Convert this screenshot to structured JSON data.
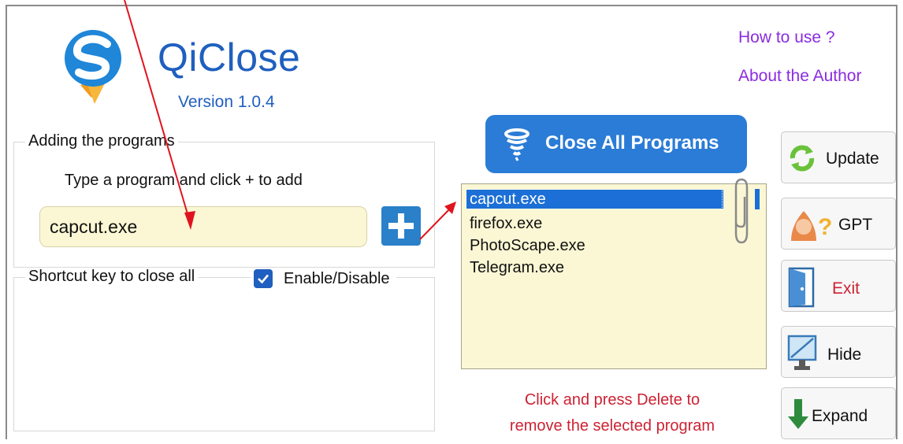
{
  "app": {
    "title": "QiClose",
    "version": "Version 1.0.4"
  },
  "links": {
    "how_to_use": "How to use ?",
    "about_author": "About the Author"
  },
  "add_group": {
    "title": "Adding the programs",
    "hint": "Type a program and click +  to add",
    "input_value": "capcut.exe"
  },
  "shortcut_group": {
    "title": "Shortcut key to close all",
    "checkbox_label": "Enable/Disable",
    "checkbox_checked": true
  },
  "close_all_label": "Close All Programs",
  "program_list": {
    "items": [
      "capcut.exe",
      "firefox.exe",
      "PhotoScape.exe",
      "Telegram.exe"
    ],
    "selected": "capcut.exe"
  },
  "remove_note": {
    "line1": "Click and press Delete to",
    "line2": "remove the selected program"
  },
  "side_buttons": {
    "update": "Update",
    "gpt": "GPT",
    "exit": "Exit",
    "hide": "Hide",
    "expand": "Expand"
  },
  "colors": {
    "accent_blue": "#2b7cd6",
    "link_purple": "#8a2ce0",
    "warning_red": "#cc2233",
    "field_yellow": "#fbf7d4",
    "annotation_red": "#e0141e"
  }
}
